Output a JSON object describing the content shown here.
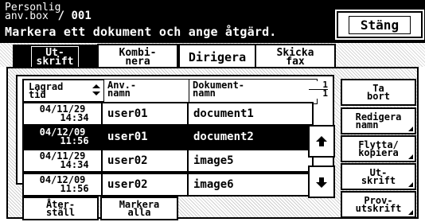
{
  "header": {
    "line1a": "Personlig",
    "line1b": "anv.box",
    "box_number": "/ 001",
    "instruction": "Markera ett dokument och ange åtgärd.",
    "close_label": "Stäng"
  },
  "tabs": [
    {
      "label1": "Ut-",
      "label2": "skrift"
    },
    {
      "label1": "Kombi-",
      "label2": "nera"
    },
    {
      "label1": "Dirigera",
      "label2": ""
    },
    {
      "label1": "Skicka",
      "label2": "fax"
    }
  ],
  "list": {
    "sort_label1": "Lagrad",
    "sort_label2": "tid",
    "col_user1": "Anv.-",
    "col_user2": "namn",
    "col_doc1": "Dokument-",
    "col_doc2": "namn",
    "page_current": "1",
    "page_total": "1",
    "rows": [
      {
        "date": "04/11/29",
        "time": "14:34",
        "user": "user01",
        "doc": "document1"
      },
      {
        "date": "04/12/09",
        "time": "11:56",
        "user": "user01",
        "doc": "document2"
      },
      {
        "date": "04/11/29",
        "time": "14:34",
        "user": "user02",
        "doc": "image5"
      },
      {
        "date": "04/12/09",
        "time": "11:56",
        "user": "user02",
        "doc": "image6"
      }
    ],
    "selected_row": 2
  },
  "side_buttons": [
    {
      "l1": "Ta",
      "l2": "bort"
    },
    {
      "l1": "Redigera",
      "l2": "namn"
    },
    {
      "l1": "Flytta/",
      "l2": "kopiera"
    },
    {
      "l1": "Ut-",
      "l2": "skrift"
    },
    {
      "l1": "Prov-",
      "l2": "utskrift"
    }
  ],
  "bottom_buttons": [
    {
      "l1": "Åter-",
      "l2": "ställ"
    },
    {
      "l1": "Markera",
      "l2": "alla"
    }
  ]
}
